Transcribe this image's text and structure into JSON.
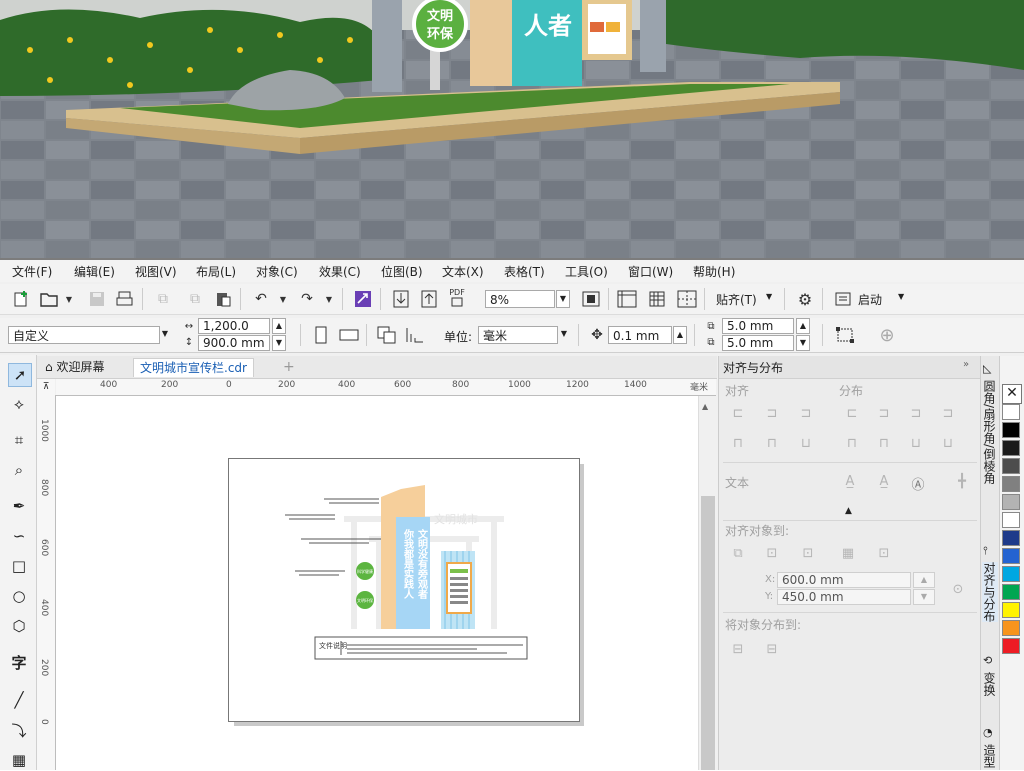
{
  "photo": {
    "board_left_text": [
      "文明",
      "环保"
    ],
    "board_center_text": "人者"
  },
  "menu": [
    "文件(F)",
    "编辑(E)",
    "视图(V)",
    "布局(L)",
    "对象(C)",
    "效果(C)",
    "位图(B)",
    "文本(X)",
    "表格(T)",
    "工具(O)",
    "窗口(W)",
    "帮助(H)"
  ],
  "toolbar1": {
    "pdf_label": "PDF",
    "zoom_value": "8%",
    "snap_label": "贴齐(T)",
    "launch_label": "启动"
  },
  "toolbar2": {
    "page_preset": "自定义",
    "width_value": "1,200.0 mm",
    "height_value": "900.0 mm",
    "units_label": "单位:",
    "units_value": "毫米",
    "nudge_value": "0.1 mm",
    "dup_x_value": "5.0 mm",
    "dup_y_value": "5.0 mm"
  },
  "tabs": {
    "welcome": "欢迎屏幕",
    "document": "文明城市宣传栏.cdr"
  },
  "ruler": {
    "h_ticks": [
      "400",
      "200",
      "0",
      "200",
      "400",
      "600",
      "800",
      "1000",
      "1200",
      "1400"
    ],
    "unit": "毫米",
    "v_ticks": [
      "1000",
      "800",
      "600",
      "400",
      "200",
      "0"
    ]
  },
  "artwork": {
    "title_text": "文明城市",
    "vertical_col1": "你我都是实践人",
    "vertical_col2": "文明没有旁观者",
    "circle1": "科学健康",
    "circle2": "文明环保",
    "note_label": "文件说明"
  },
  "docker": {
    "title": "对齐与分布",
    "align_label": "对齐",
    "distribute_label": "分布",
    "text_label": "文本",
    "align_to_label": "对齐对象到:",
    "x_label": "X:",
    "x_value": "600.0 mm",
    "y_label": "Y:",
    "y_value": "450.0 mm",
    "distribute_to_label": "将对象分布到:"
  },
  "side_tabs": [
    "圆角/扇形角/倒棱角",
    "对齐与分布",
    "变换",
    "造型"
  ],
  "palette_colors": [
    "#ffffff",
    "#000000",
    "#1a1a1a",
    "#4d4d4d",
    "#808080",
    "#b3b3b3",
    "#ffffff",
    "#1e3a8a",
    "#2463d1",
    "#00a7e1",
    "#00a651",
    "#fff200",
    "#f7941d",
    "#ed1c24"
  ]
}
